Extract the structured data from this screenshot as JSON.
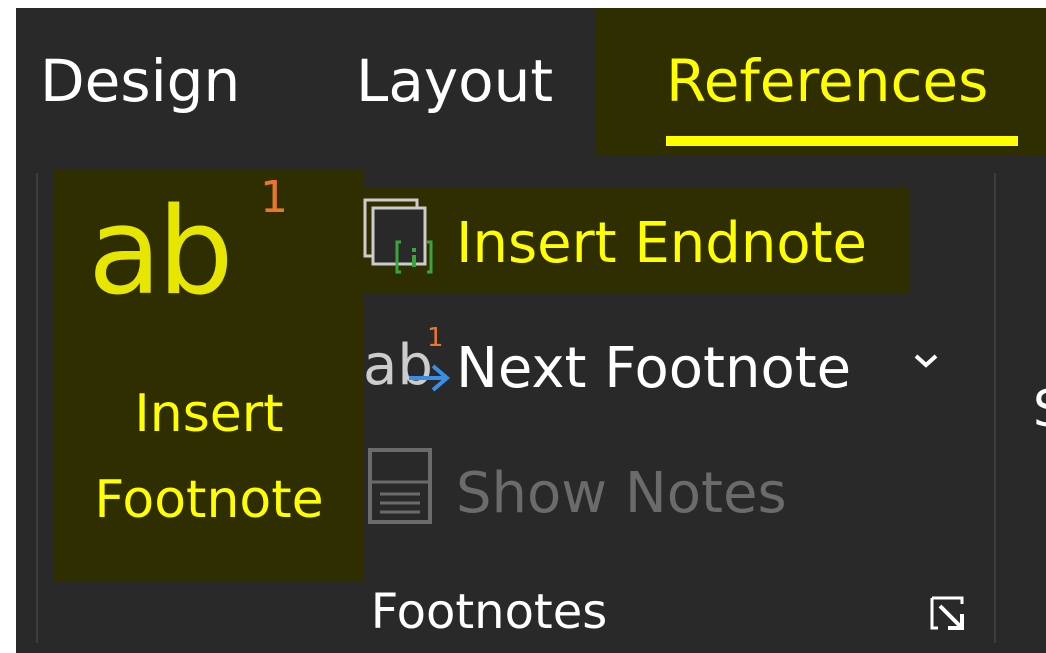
{
  "tabs": [
    {
      "label": "Design",
      "active": false
    },
    {
      "label": "Layout",
      "active": false
    },
    {
      "label": "References",
      "active": true
    }
  ],
  "footnotes_group": {
    "name": "Footnotes",
    "insert_footnote": {
      "icon_text": "ab",
      "icon_superscript": "1",
      "label_line1": "Insert",
      "label_line2": "Footnote"
    },
    "insert_endnote": {
      "label": "Insert Endnote",
      "icon": "insert-endnote-icon"
    },
    "next_footnote": {
      "label": "Next Footnote",
      "icon": "next-footnote-icon",
      "icon_superscript": "1",
      "dropdown_icon": "chevron-down-icon"
    },
    "show_notes": {
      "label": "Show Notes",
      "icon": "show-notes-icon",
      "enabled": false
    },
    "launcher_icon": "dialog-launcher-icon"
  },
  "next_group_partial_text": "S",
  "colors": {
    "ribbon_bg": "#292929",
    "highlight_bg": "#2f2e00",
    "highlight_text": "#ffff00",
    "text": "#ffffff",
    "disabled_text": "#6b6b6b",
    "accent_orange": "#e8762c",
    "accent_blue": "#3a8ee6",
    "accent_green": "#3aa63a"
  }
}
